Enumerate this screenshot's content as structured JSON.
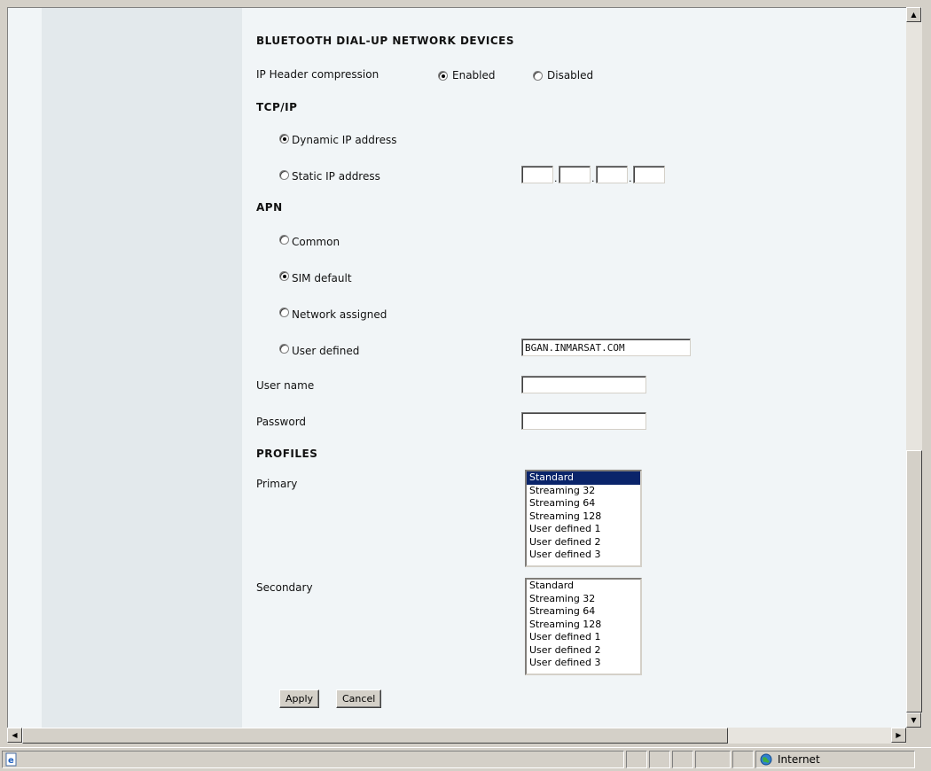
{
  "sections": {
    "bluetooth": "BLUETOOTH DIAL-UP NETWORK DEVICES",
    "tcpip": "TCP/IP",
    "apn": "APN",
    "profiles": "PROFILES"
  },
  "ip_header": {
    "label": "IP Header compression",
    "enabled_label": "Enabled",
    "disabled_label": "Disabled",
    "selected": "Enabled"
  },
  "tcpip": {
    "dynamic_label": "Dynamic IP address",
    "static_label": "Static IP address",
    "selected": "Dynamic IP address",
    "static_octets": [
      "",
      "",
      "",
      ""
    ],
    "separator": "."
  },
  "apn": {
    "common_label": "Common",
    "sim_default_label": "SIM default",
    "network_assigned_label": "Network assigned",
    "user_defined_label": "User defined",
    "selected": "SIM default",
    "user_defined_value": "BGAN.INMARSAT.COM"
  },
  "credentials": {
    "username_label": "User name",
    "username_value": "",
    "password_label": "Password",
    "password_value": ""
  },
  "profiles": {
    "primary_label": "Primary",
    "secondary_label": "Secondary",
    "options": [
      "Standard",
      "Streaming 32",
      "Streaming 64",
      "Streaming 128",
      "User defined 1",
      "User defined 2",
      "User defined 3"
    ],
    "primary_selected": "Standard",
    "secondary_selected": ""
  },
  "buttons": {
    "apply": "Apply",
    "cancel": "Cancel"
  },
  "scrollbar_icons": {
    "up": "scroll-up-arrow",
    "down": "scroll-down-arrow",
    "left": "scroll-left-arrow",
    "right": "scroll-right-arrow"
  },
  "statusbar": {
    "zone": "Internet",
    "page_icon": "ie-page-icon",
    "zone_icon": "globe-icon"
  }
}
